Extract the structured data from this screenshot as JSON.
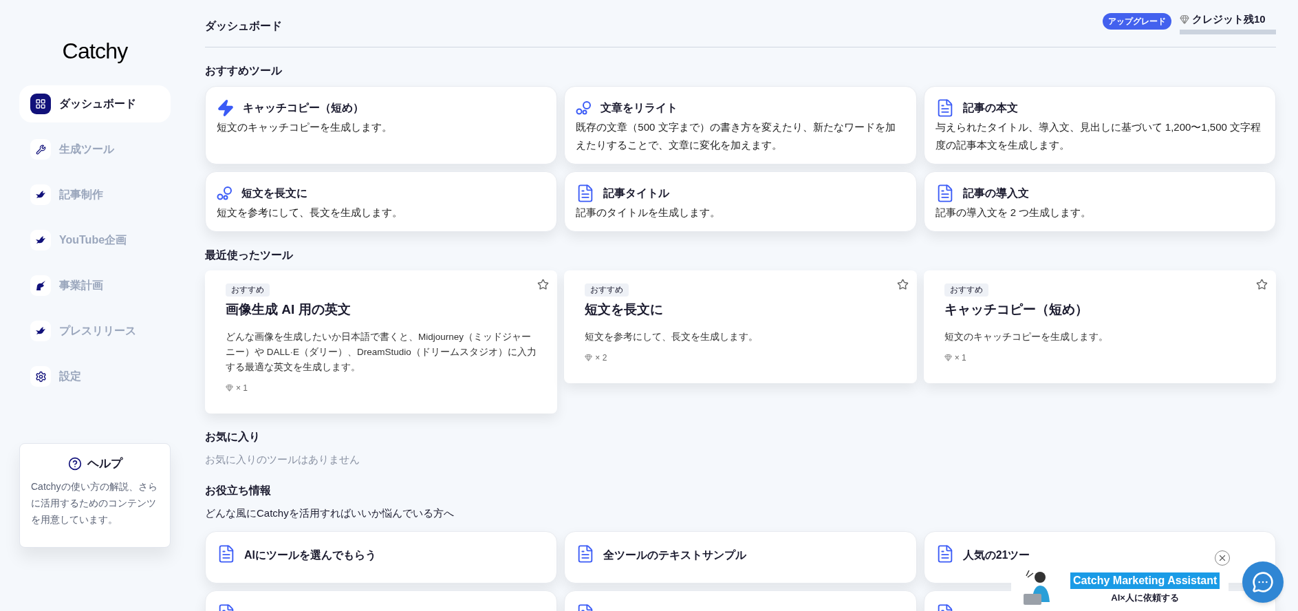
{
  "sidebar": {
    "logo": "Catchy",
    "items": [
      {
        "label": "ダッシュボード",
        "selected": true
      },
      {
        "label": "生成ツール",
        "selected": false
      },
      {
        "label": "記事制作",
        "selected": false
      },
      {
        "label": "YouTube企画",
        "selected": false
      },
      {
        "label": "事業計画",
        "selected": false
      },
      {
        "label": "プレスリリース",
        "selected": false
      },
      {
        "label": "設定",
        "selected": false
      }
    ],
    "help": {
      "title": "ヘルプ",
      "text": "Catchyの使い方の解説、さらに活用するためのコンテンツを用意しています。"
    }
  },
  "header": {
    "title": "ダッシュボード",
    "upgrade": "アップグレード",
    "credits": "クレジット残10"
  },
  "recommended": {
    "heading": "おすすめツール",
    "tools": [
      {
        "title": "キャッチコピー（短め）",
        "description": "短文のキャッチコピーを生成します。"
      },
      {
        "title": "文章をリライト",
        "description": "既存の文章（500 文字まで）の書き方を変えたり、新たなワードを加えたりすることで、文章に変化を加えます。"
      },
      {
        "title": "記事の本文",
        "description": "与えられたタイトル、導入文、見出しに基づいて 1,200〜1,500 文字程度の記事本文を生成します。"
      },
      {
        "title": "短文を長文に",
        "description": "短文を参考にして、長文を生成します。"
      },
      {
        "title": "記事タイトル",
        "description": "記事のタイトルを生成します。"
      },
      {
        "title": "記事の導入文",
        "description": "記事の導入文を 2 つ生成します。"
      }
    ]
  },
  "recent": {
    "heading": "最近使ったツール",
    "tools": [
      {
        "badge": "おすすめ",
        "title": "画像生成 AI 用の英文",
        "description": "どんな画像を生成したいか日本語で書くと、Midjourney（ミッドジャーニー）や DALL·E（ダリー）、DreamStudio（ドリームスタジオ）に入力する最適な英文を生成します。",
        "cost": "× 1"
      },
      {
        "badge": "おすすめ",
        "title": "短文を長文に",
        "description": "短文を参考にして、長文を生成します。",
        "cost": "× 2"
      },
      {
        "badge": "おすすめ",
        "title": "キャッチコピー（短め）",
        "description": "短文のキャッチコピーを生成します。",
        "cost": "× 1"
      }
    ]
  },
  "favorites": {
    "heading": "お気に入り",
    "empty": "お気に入りのツールはありません"
  },
  "tips": {
    "heading": "お役立ち情報",
    "subtitle": "どんな風にCatchyを活用すればいいか悩んでいる方へ",
    "items": [
      {
        "kind": "card",
        "title": "AIにツールを選んでもらう"
      },
      {
        "kind": "card",
        "title": "全ツールのテキストサンプル"
      },
      {
        "kind": "card",
        "title": "人気の21ツー"
      },
      {
        "kind": "cut_off"
      },
      {
        "kind": "cut_off"
      },
      {
        "kind": "cut_off"
      }
    ]
  },
  "assistant_popup": {
    "title": "Catchy Marketing Assistant",
    "subtitle": "AI×人に依頼する"
  }
}
